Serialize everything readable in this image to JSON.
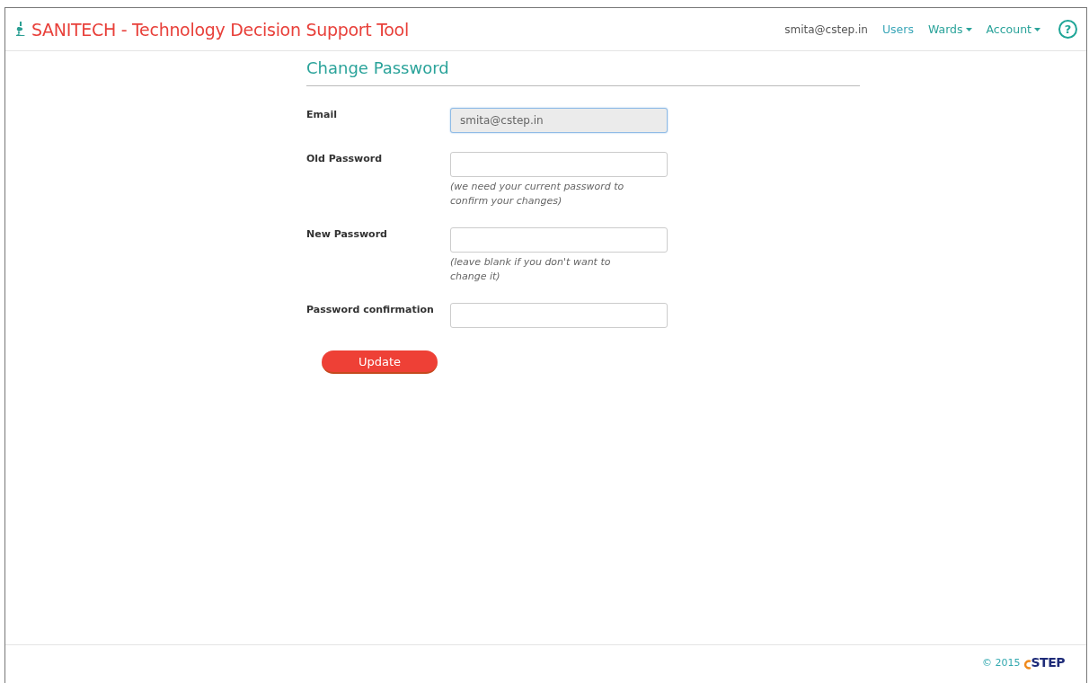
{
  "navbar": {
    "brand": "SANITECH - Technology Decision Support Tool",
    "user": "smita@cstep.in",
    "links": [
      {
        "label": "Users",
        "dropdown": false
      },
      {
        "label": "Wards",
        "dropdown": true
      },
      {
        "label": "Account",
        "dropdown": true
      }
    ],
    "help": "?"
  },
  "page_title": "Change Password",
  "fields": [
    {
      "label": "Email",
      "value": "smita@cstep.in",
      "disabled": true
    },
    {
      "label": "Old Password",
      "disabled": false,
      "hint": "(we need your current password to confirm your changes)"
    },
    {
      "label": "New Password",
      "disabled": false,
      "hint": "(leave blank if you don't want to change it)"
    },
    {
      "label": "Password confirmation",
      "disabled": false
    }
  ],
  "submit": "Update",
  "footer": {
    "copyright": "© 2015",
    "logo": "STEP"
  }
}
